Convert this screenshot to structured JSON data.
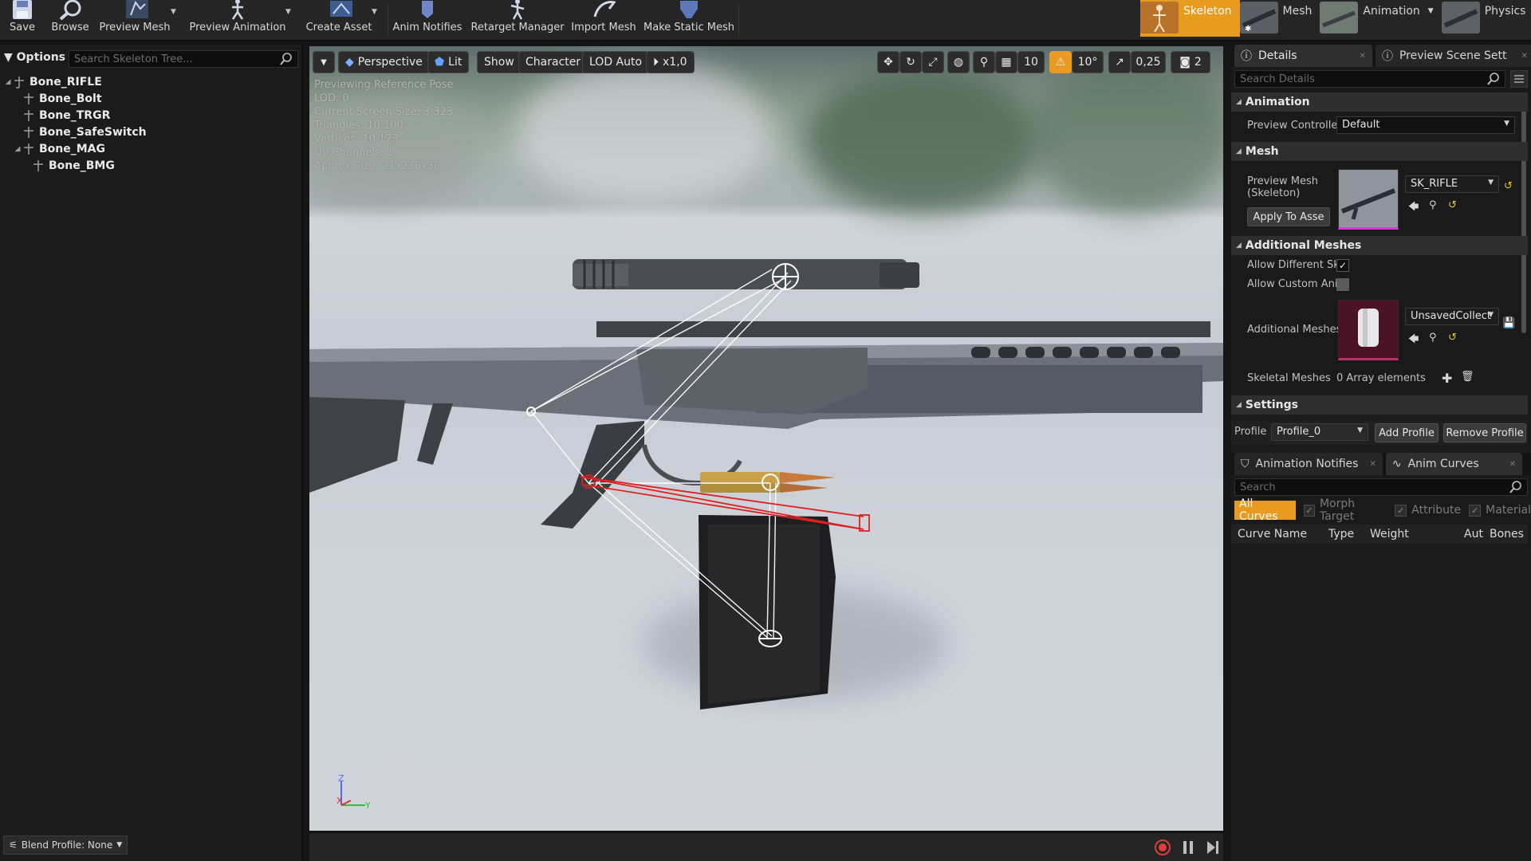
{
  "toolbar": {
    "save": "Save",
    "browse": "Browse",
    "preview_mesh": "Preview Mesh",
    "preview_animation": "Preview Animation",
    "create_asset": "Create Asset",
    "anim_notifies": "Anim Notifies",
    "retarget_manager": "Retarget Manager",
    "import_mesh": "Import Mesh",
    "make_static_mesh": "Make Static Mesh"
  },
  "modes": {
    "skeleton": "Skeleton",
    "mesh": "Mesh",
    "animation": "Animation",
    "physics": "Physics"
  },
  "skeleton_tree": {
    "options": "Options",
    "search_placeholder": "Search Skeleton Tree...",
    "bones": [
      "Bone_RIFLE",
      "Bone_Bolt",
      "Bone_TRGR",
      "Bone_SafeSwitch",
      "Bone_MAG",
      "Bone_BMG"
    ],
    "blend_profile": "Blend Profile: None"
  },
  "viewport": {
    "perspective": "Perspective",
    "lit": "Lit",
    "show": "Show",
    "character": "Character",
    "lod": "LOD Auto",
    "speed": "x1,0",
    "grid_snap": "10",
    "rot_snap": "10°",
    "scale_snap": "0,25",
    "cam_speed": "2",
    "info": {
      "line1": "Previewing Reference Pose",
      "line2": "LOD: 0",
      "line3": "Current Screen Size: 3,323",
      "line4": "Triangles: 10 100",
      "line5": "Vertices: 10 173",
      "line6": "UV Channels: 1",
      "line7": "Approx Size: 21x236x36"
    },
    "axis_z": "Z",
    "axis_x": "X",
    "axis_y": "Y"
  },
  "details": {
    "tab_details": "Details",
    "tab_scene": "Preview Scene Sett",
    "search_placeholder": "Search Details",
    "cat_animation": "Animation",
    "preview_controller_label": "Preview Controller",
    "preview_controller_value": "Default",
    "cat_mesh": "Mesh",
    "preview_mesh_label": "Preview Mesh (Skeleton)",
    "preview_mesh_value": "SK_RIFLE",
    "apply_to_asset": "Apply To Asse",
    "cat_additional": "Additional Meshes",
    "allow_different_label": "Allow Different Sk",
    "allow_different_checked": true,
    "allow_custom_label": "Allow Custom Ani",
    "allow_custom_checked": false,
    "additional_meshes_label": "Additional Meshes",
    "additional_meshes_value": "UnsavedCollect",
    "skeletal_meshes_label": "Skeletal Meshes",
    "skeletal_meshes_value": "0 Array elements",
    "cat_settings": "Settings",
    "profile_label": "Profile",
    "profile_value": "Profile_0",
    "add_profile": "Add Profile",
    "remove_profile": "Remove Profile"
  },
  "curves": {
    "tab_notifies": "Animation Notifies",
    "tab_curves": "Anim Curves",
    "search_placeholder": "Search",
    "all_curves": "All Curves",
    "morph_target": "Morph Target",
    "attribute": "Attribute",
    "material": "Material",
    "col_curve_name": "Curve Name",
    "col_type": "Type",
    "col_weight": "Weight",
    "col_auto": "Aut",
    "col_bones": "Bones"
  },
  "colors": {
    "accent": "#e89b20",
    "panel": "#1b1b1b",
    "bone_selected": "#e02020"
  }
}
